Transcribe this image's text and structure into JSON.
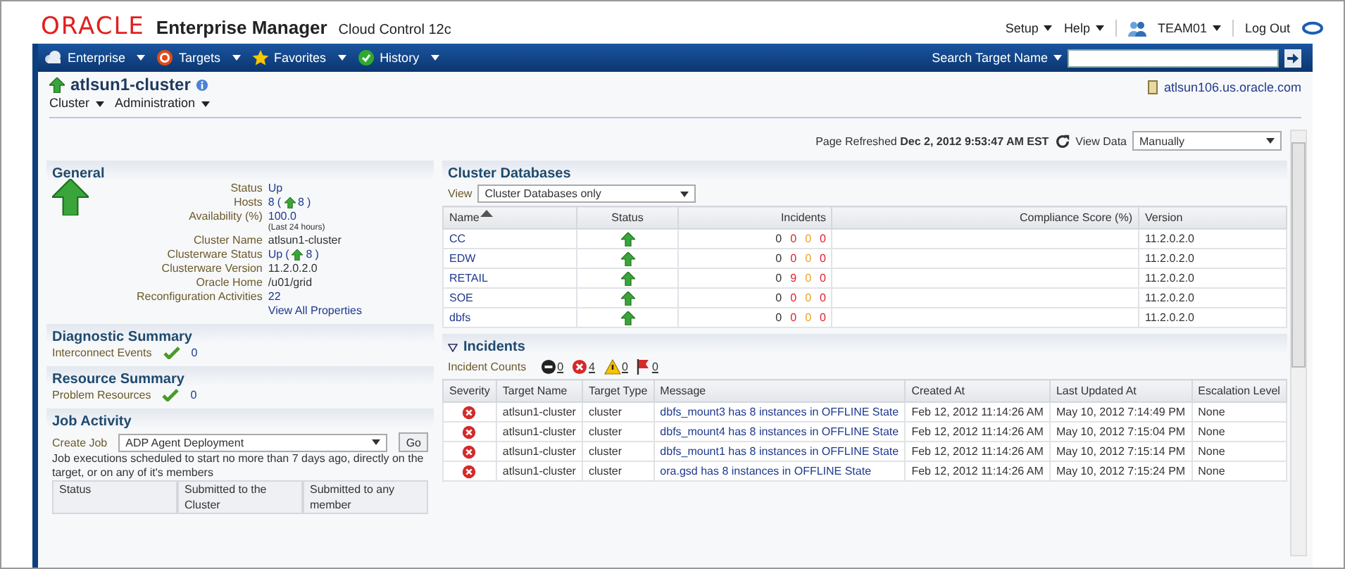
{
  "header": {
    "brand": "ORACLE",
    "product": "Enterprise Manager",
    "edition": "Cloud Control 12c",
    "links": [
      {
        "label": "Setup",
        "kind": "menu"
      },
      {
        "label": "Help",
        "kind": "menu"
      },
      {
        "label": "TEAM01",
        "kind": "user"
      },
      {
        "label": "Log Out",
        "kind": "plain"
      }
    ]
  },
  "nav": {
    "menus": [
      {
        "label": "Enterprise",
        "kind": "cloud"
      },
      {
        "label": "Targets",
        "kind": "target"
      },
      {
        "label": "Favorites",
        "kind": "star"
      },
      {
        "label": "History",
        "kind": "history"
      }
    ],
    "search_label": "Search Target Name"
  },
  "target": {
    "name": "atlsun1-cluster",
    "menus": [
      "Cluster",
      "Administration"
    ],
    "host": "atlsun106.us.oracle.com"
  },
  "refresh": {
    "label": "Page Refreshed",
    "time": "Dec 2, 2012 9:53:47 AM EST",
    "view_label": "View Data",
    "view_value": "Manually"
  },
  "general": {
    "title": "General",
    "properties": [
      {
        "label": "Status",
        "value": "Up",
        "kind": "text"
      },
      {
        "label": "Hosts",
        "value": "8",
        "open": "(",
        "up": "8",
        "close": ")",
        "kind": "count"
      },
      {
        "label": "Availability (%)",
        "value": "100.0",
        "note": "(Last 24 hours)",
        "kind": "link"
      },
      {
        "label": "Cluster Name",
        "value": "atlsun1-cluster",
        "kind": "plain"
      },
      {
        "label": "Clusterware Status",
        "value": "Up",
        "open": "(",
        "up": "8",
        "close": ")",
        "kind": "count"
      },
      {
        "label": "Clusterware Version",
        "value": "11.2.0.2.0",
        "kind": "plain"
      },
      {
        "label": "Oracle Home",
        "value": "/u01/grid",
        "kind": "plain"
      },
      {
        "label": "Reconfiguration Activities",
        "value": "22",
        "kind": "link"
      }
    ],
    "more": "View All Properties"
  },
  "diagnostic": {
    "title": "Diagnostic Summary",
    "label": "Interconnect Events",
    "value": "0"
  },
  "resource": {
    "title": "Resource Summary",
    "label": "Problem Resources",
    "value": "0"
  },
  "jobs": {
    "title": "Job Activity",
    "label": "Create Job",
    "value": "ADP Agent Deployment",
    "button": "Go",
    "note": "Job executions scheduled to start no more than 7 days ago, directly on the target, or on any of it's members",
    "columns": [
      "Status",
      "Submitted to the Cluster",
      "Submitted to any member"
    ]
  },
  "databases": {
    "title": "Cluster Databases",
    "view_label": "View",
    "view_value": "Cluster Databases only",
    "columns": [
      "Name",
      "Status",
      "Incidents",
      "Compliance Score (%)",
      "Version"
    ],
    "rows": [
      {
        "name": "CC",
        "incidents": [
          {
            "value": "0",
            "color": "#333333"
          },
          {
            "value": "0",
            "color": "#e0202a"
          },
          {
            "value": "0",
            "color": "#f0a020"
          },
          {
            "value": "0",
            "color": "#e0202a"
          }
        ],
        "version": "11.2.0.2.0"
      },
      {
        "name": "EDW",
        "incidents": [
          {
            "value": "0",
            "color": "#333333"
          },
          {
            "value": "0",
            "color": "#e0202a"
          },
          {
            "value": "0",
            "color": "#f0a020"
          },
          {
            "value": "0",
            "color": "#e0202a"
          }
        ],
        "version": "11.2.0.2.0"
      },
      {
        "name": "RETAIL",
        "incidents": [
          {
            "value": "0",
            "color": "#333333"
          },
          {
            "value": "9",
            "color": "#e0202a"
          },
          {
            "value": "0",
            "color": "#f0a020"
          },
          {
            "value": "0",
            "color": "#e0202a"
          }
        ],
        "version": "11.2.0.2.0"
      },
      {
        "name": "SOE",
        "incidents": [
          {
            "value": "0",
            "color": "#333333"
          },
          {
            "value": "0",
            "color": "#e0202a"
          },
          {
            "value": "0",
            "color": "#f0a020"
          },
          {
            "value": "0",
            "color": "#e0202a"
          }
        ],
        "version": "11.2.0.2.0"
      },
      {
        "name": "dbfs",
        "incidents": [
          {
            "value": "0",
            "color": "#333333"
          },
          {
            "value": "0",
            "color": "#e0202a"
          },
          {
            "value": "0",
            "color": "#f0a020"
          },
          {
            "value": "0",
            "color": "#e0202a"
          }
        ],
        "version": "11.2.0.2.0"
      }
    ]
  },
  "incidents": {
    "title": "Incidents",
    "expanded": true,
    "counts_label": "Incident Counts",
    "counts": [
      {
        "kind": "fatal",
        "value": "0"
      },
      {
        "kind": "critical",
        "value": "4"
      },
      {
        "kind": "warning",
        "value": "0"
      },
      {
        "kind": "escalated",
        "value": "0"
      }
    ],
    "columns": [
      "Severity",
      "Target Name",
      "Target Type",
      "Message",
      "Created At",
      "Last Updated At",
      "Escalation Level"
    ],
    "rows": [
      {
        "target": "atlsun1-cluster",
        "type": "cluster",
        "message": "dbfs_mount3 has 8 instances in OFFLINE State",
        "created": "Feb 12, 2012 11:14:26 AM",
        "updated": "May 10, 2012 7:14:49 PM",
        "escalation": "None"
      },
      {
        "target": "atlsun1-cluster",
        "type": "cluster",
        "message": "dbfs_mount4 has 8 instances in OFFLINE State",
        "created": "Feb 12, 2012 11:14:26 AM",
        "updated": "May 10, 2012 7:15:04 PM",
        "escalation": "None"
      },
      {
        "target": "atlsun1-cluster",
        "type": "cluster",
        "message": "dbfs_mount1 has 8 instances in OFFLINE State",
        "created": "Feb 12, 2012 11:14:26 AM",
        "updated": "May 10, 2012 7:15:14 PM",
        "escalation": "None"
      },
      {
        "target": "atlsun1-cluster",
        "type": "cluster",
        "message": "ora.gsd has 8 instances in OFFLINE State",
        "created": "Feb 12, 2012 11:14:26 AM",
        "updated": "May 10, 2012 7:15:24 PM",
        "escalation": "None"
      }
    ]
  }
}
